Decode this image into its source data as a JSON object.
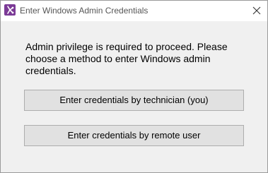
{
  "window": {
    "title": "Enter Windows Admin Credentials",
    "app_icon": "app-logo-icon",
    "close_icon": "close-icon"
  },
  "message": "Admin privilege is required to proceed. Please choose a method to enter Windows admin credentials.",
  "buttons": {
    "technician_label": "Enter credentials by technician (you)",
    "remote_label": "Enter credentials by remote user"
  },
  "colors": {
    "accent": "#7b3a96",
    "button_face": "#e1e1e1",
    "dialog_bg": "#f0f0f0"
  }
}
